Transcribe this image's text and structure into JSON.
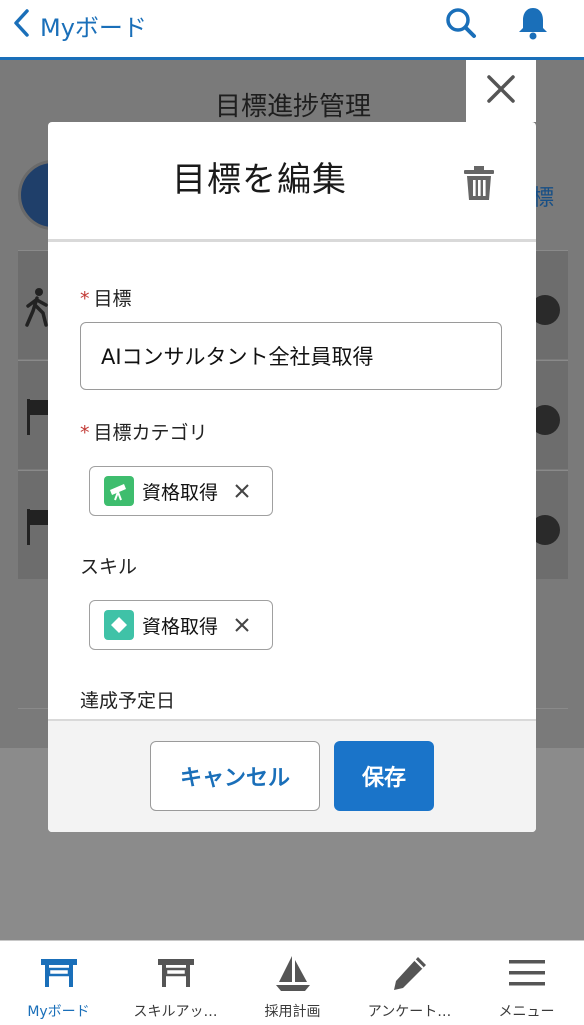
{
  "header": {
    "back_label": "Myボード"
  },
  "background_page": {
    "title": "目標進捗管理",
    "link_text": "標"
  },
  "modal": {
    "title": "目標を編集",
    "goal": {
      "label": "目標",
      "value": "AIコンサルタント全社員取得"
    },
    "category": {
      "label": "目標カテゴリ",
      "tag": "資格取得"
    },
    "skill": {
      "label": "スキル",
      "tag": "資格取得"
    },
    "due_date": {
      "label": "達成予定日"
    },
    "required_mark": "*",
    "cancel_label": "キャンセル",
    "save_label": "保存"
  },
  "bottom_nav": {
    "items": [
      {
        "label": "Myボード",
        "icon": "board-icon",
        "active": true
      },
      {
        "label": "スキルアッ…",
        "icon": "board-icon",
        "active": false
      },
      {
        "label": "採用計画",
        "icon": "sailboat-icon",
        "active": false
      },
      {
        "label": "アンケート…",
        "icon": "pencil-icon",
        "active": false
      },
      {
        "label": "メニュー",
        "icon": "hamburger-icon",
        "active": false
      }
    ]
  },
  "colors": {
    "brand_blue": "#1a6fb9",
    "save_blue": "#1a74c9",
    "required_red": "#c23934",
    "category_icon_green": "#3ebd6e",
    "skill_icon_teal": "#3fc2a7"
  }
}
